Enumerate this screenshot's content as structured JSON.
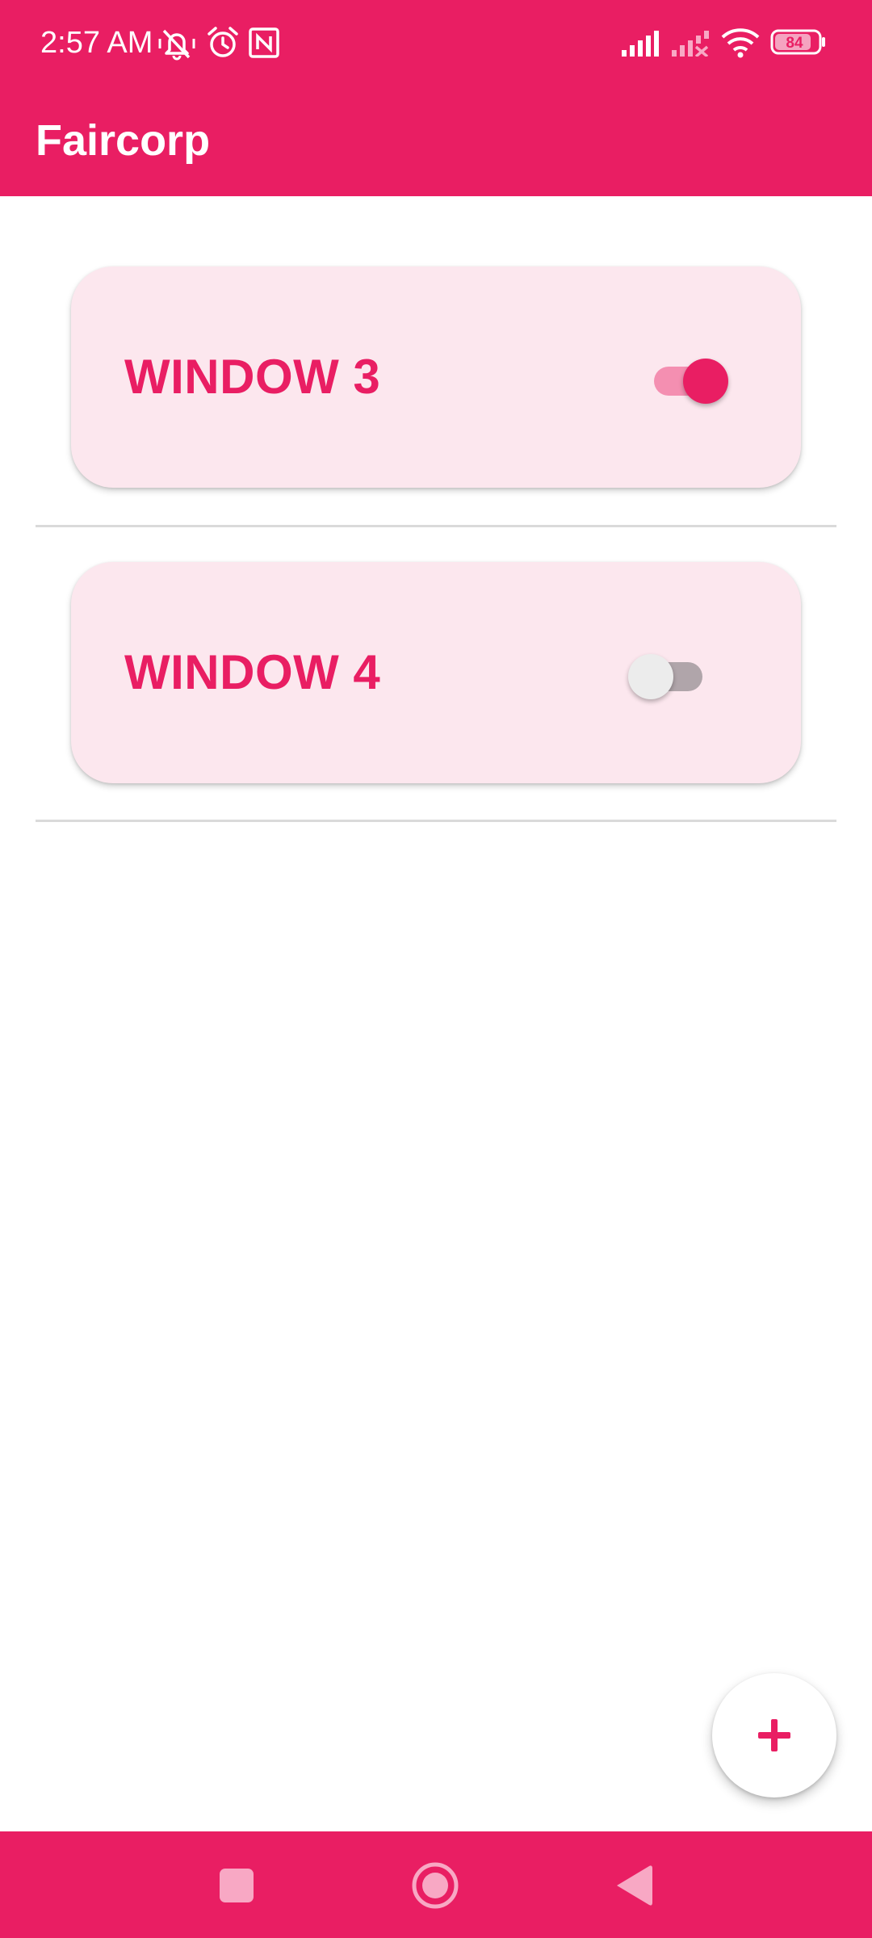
{
  "status_bar": {
    "time": "2:57 AM",
    "icons": [
      "muted-bell-icon",
      "alarm-icon",
      "nfc-icon",
      "signal-icon",
      "signal-no-sim-icon",
      "wifi-icon",
      "battery-icon"
    ],
    "battery_level": "84"
  },
  "app_bar": {
    "title": "Faircorp"
  },
  "windows": [
    {
      "label": "WINDOW 3",
      "open": true
    },
    {
      "label": "WINDOW 4",
      "open": false
    }
  ],
  "fab": {
    "icon": "plus-icon"
  },
  "nav_bar": {
    "buttons": [
      "recents-icon",
      "home-icon",
      "back-icon"
    ]
  },
  "colors": {
    "primary": "#E91E63",
    "card_background": "#FCE7EE",
    "switch_on_track": "#F48FB1",
    "switch_off_thumb": "#ECECEC",
    "switch_off_track": "#B0A5AA"
  }
}
